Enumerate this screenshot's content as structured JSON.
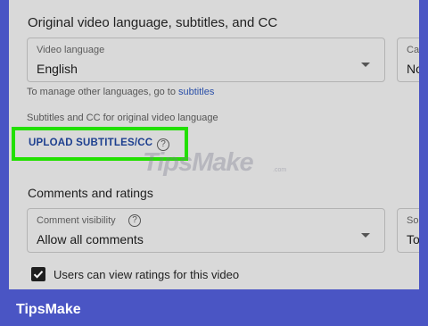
{
  "section_language": {
    "title": "Original video language, subtitles, and CC"
  },
  "video_language": {
    "label": "Video language",
    "value": "English"
  },
  "side_field_top": {
    "label": "Ca",
    "value": "No"
  },
  "manage_text": {
    "prefix": "To manage other languages, go to ",
    "link": "subtitles"
  },
  "subtitles_caption": "Subtitles and CC for original video language",
  "upload": {
    "label": "UPLOAD SUBTITLES/CC",
    "help": "?"
  },
  "watermark": {
    "brand": "TipsMake",
    "suffix": ".com"
  },
  "section_comments": {
    "title": "Comments and ratings"
  },
  "comment_visibility": {
    "label": "Comment visibility",
    "help": "?",
    "value": "Allow all comments"
  },
  "side_field_bottom": {
    "label": "So",
    "value": "To"
  },
  "ratings_checkbox": {
    "label": "Users can view ratings for this video",
    "checked": true
  },
  "footer": {
    "brand": "TipsMake"
  },
  "colors": {
    "frame": "#4a55c4",
    "highlight": "#22e000",
    "link": "#2a4fa8",
    "upload_text": "#1d3f8f"
  }
}
